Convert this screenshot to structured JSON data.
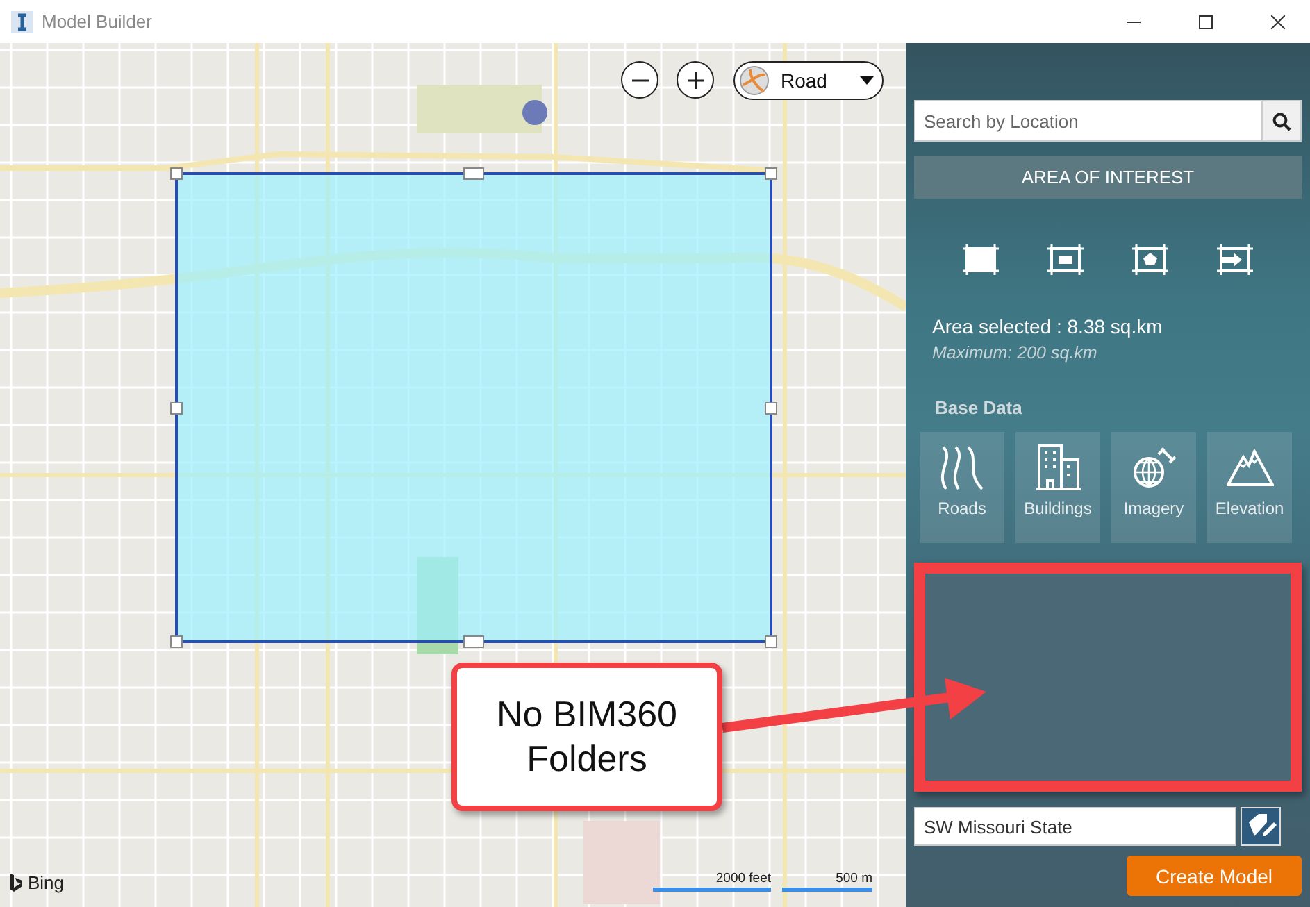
{
  "window": {
    "title": "Model Builder"
  },
  "map": {
    "style_picker": {
      "value": "Road"
    },
    "attribution": "Bing",
    "scale": [
      "2000 feet",
      "500 m"
    ]
  },
  "callout": {
    "text": "No BIM360 Folders"
  },
  "panel": {
    "search": {
      "placeholder": "Search by Location"
    },
    "area_button": "AREA OF INTEREST",
    "tools": [
      {
        "kind": "rectangle"
      },
      {
        "kind": "inset"
      },
      {
        "kind": "polygon"
      },
      {
        "kind": "import"
      }
    ],
    "area_selected": "Area selected : 8.38 sq.km",
    "maximum": "Maximum: 200 sq.km",
    "base_data_heading": "Base Data",
    "base_data": [
      {
        "kind": "roads",
        "label": "Roads"
      },
      {
        "kind": "buildings",
        "label": "Buildings"
      },
      {
        "kind": "imagery",
        "label": "Imagery"
      },
      {
        "kind": "elevation",
        "label": "Elevation"
      }
    ],
    "name_field": {
      "value": "SW Missouri State"
    },
    "create_button": "Create Model"
  }
}
